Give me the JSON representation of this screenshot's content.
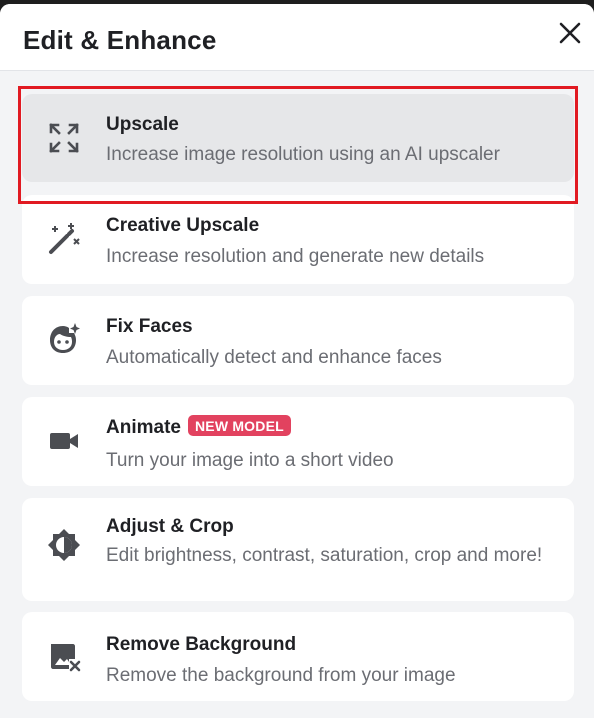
{
  "dialog": {
    "title": "Edit & Enhance",
    "close_icon": "close-icon"
  },
  "options": [
    {
      "name": "Upscale",
      "description": "Increase image resolution using an AI upscaler",
      "icon": "expand-arrows-icon",
      "selected": true
    },
    {
      "name": "Creative Upscale",
      "description": "Increase resolution and generate new details",
      "icon": "magic-wand-icon"
    },
    {
      "name": "Fix Faces",
      "description": "Automatically detect and enhance faces",
      "icon": "face-sparkle-icon"
    },
    {
      "name": "Animate",
      "badge": "NEW MODEL",
      "description": "Turn your image into a short video",
      "icon": "video-camera-icon"
    },
    {
      "name": "Adjust & Crop",
      "description": "Edit brightness, contrast, saturation, crop and more!",
      "icon": "brightness-icon"
    },
    {
      "name": "Remove Background",
      "description": "Remove the background from your image",
      "icon": "image-remove-icon"
    }
  ],
  "colors": {
    "badge": "#e2425f",
    "selection_outline": "#e11a22",
    "selected_card": "#e6e7e9",
    "icon": "#4b4d52"
  }
}
